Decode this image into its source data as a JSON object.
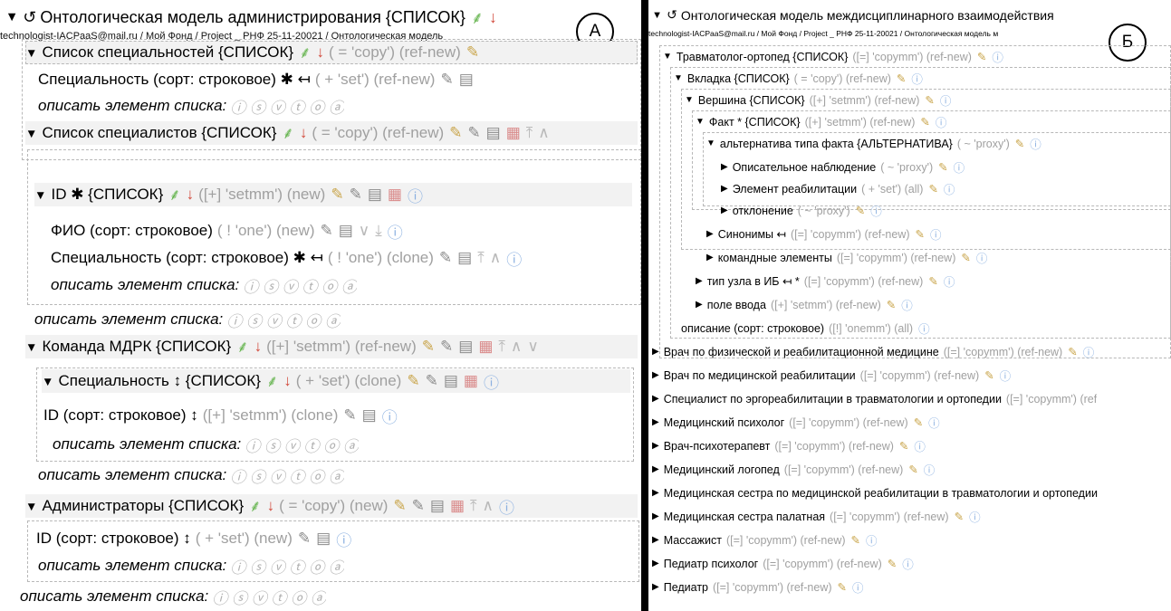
{
  "labels": {
    "a": "А",
    "b": "Б"
  },
  "left": {
    "title": "Онтологическая модель администрирования {СПИСОК}",
    "breadcrumb": "technologist-IACPaaS@mail.ru / Мой Фонд / Project _ РНФ 25-11-20021 / Онтологическая модель",
    "rows": [
      {
        "text": "Список специальностей {СПИСОК}",
        "meta": "( = 'copy') (ref-new)"
      },
      {
        "text": "Специальность (сорт: строковое) ✱ ↤",
        "meta": "( + 'set') (ref-new)"
      },
      {
        "text": "описать элемент списка:"
      },
      {
        "text": "Список специалистов {СПИСОК}",
        "meta": "( = 'copy') (ref-new)"
      },
      {
        "text": "ID ✱ {СПИСОК}",
        "meta": "([+] 'setmm') (new)"
      },
      {
        "text": "ФИО (сорт: строковое)",
        "meta": "( ! 'one') (new)"
      },
      {
        "text": "Специальность (сорт: строковое) ✱ ↤",
        "meta": "( ! 'one') (clone)"
      },
      {
        "text": "описать элемент списка:"
      },
      {
        "text": "описать элемент списка:"
      },
      {
        "text": "Команда МДРК {СПИСОК}",
        "meta": "([+] 'setmm') (ref-new)"
      },
      {
        "text": "Специальность ↕ {СПИСОК}",
        "meta": "( + 'set') (clone)"
      },
      {
        "text": "ID (сорт: строковое) ↕",
        "meta": "([+] 'setmm') (clone)"
      },
      {
        "text": "описать элемент списка:"
      },
      {
        "text": "описать элемент списка:"
      },
      {
        "text": "Администраторы {СПИСОК}",
        "meta": "( = 'copy') (new)"
      },
      {
        "text": "ID (сорт: строковое) ↕",
        "meta": "( + 'set') (new)"
      },
      {
        "text": "описать элемент списка:"
      },
      {
        "text": "описать элемент списка:"
      }
    ]
  },
  "right": {
    "title": "Онтологическая модель междисциплинарного взаимодействия",
    "breadcrumb": "technologist-IACPaaS@mail.ru / Мой Фонд / Project _ РНФ 25-11-20021 / Онтологическая модель м",
    "rows": [
      {
        "text": "Травматолог-ортопед {СПИСОК}",
        "meta": "([=] 'copymm') (ref-new)"
      },
      {
        "text": "Вкладка {СПИСОК}",
        "meta": "( = 'copy') (ref-new)"
      },
      {
        "text": "Вершина {СПИСОК}",
        "meta": "([+] 'setmm') (ref-new)"
      },
      {
        "text": "Факт * {СПИСОК}",
        "meta": "([+] 'setmm') (ref-new)"
      },
      {
        "text": "альтернатива типа факта {АЛЬТЕРНАТИВА}",
        "meta": "( ~ 'proxy')"
      },
      {
        "text": "Описательное наблюдение",
        "meta": "( ~ 'proxy')"
      },
      {
        "text": "Элемент реабилитации",
        "meta": "( + 'set') (all)"
      },
      {
        "text": "отклонение",
        "meta": "( ~ 'proxy')"
      },
      {
        "text": "Синонимы ↤",
        "meta": "([=] 'copymm') (ref-new)"
      },
      {
        "text": "командные элементы",
        "meta": "([=] 'copymm') (ref-new)"
      },
      {
        "text": "тип узла в ИБ ↤ *",
        "meta": "([=] 'copymm') (ref-new)"
      },
      {
        "text": "поле ввода",
        "meta": "([+] 'setmm') (ref-new)"
      },
      {
        "text": "описание (сорт: строковое)",
        "meta": "([!] 'onemm') (all)"
      },
      {
        "text": "Врач по физической и реабилитационной медицине",
        "meta": "([=] 'copymm') (ref-new)"
      },
      {
        "text": "Врач по медицинской реабилитации",
        "meta": "([=] 'copymm') (ref-new)"
      },
      {
        "text": "Специалист по эргореабилитации в травматологии и ортопедии",
        "meta": "([=] 'copymm') (ref"
      },
      {
        "text": "Медицинский психолог",
        "meta": "([=] 'copymm') (ref-new)"
      },
      {
        "text": "Врач-психотерапевт",
        "meta": "([=] 'copymm') (ref-new)"
      },
      {
        "text": "Медицинский логопед",
        "meta": "([=] 'copymm') (ref-new)"
      },
      {
        "text": "Медицинская сестра по медицинской реабилитации в травматологии и ортопедии"
      },
      {
        "text": "Медицинская сестра палатная",
        "meta": "([=] 'copymm') (ref-new)"
      },
      {
        "text": "Массажист",
        "meta": "([=] 'copymm') (ref-new)"
      },
      {
        "text": "Педиатр психолог",
        "meta": "([=] 'copymm') (ref-new)"
      },
      {
        "text": "Педиатр",
        "meta": "([=] 'copymm') (ref-new)"
      }
    ]
  }
}
